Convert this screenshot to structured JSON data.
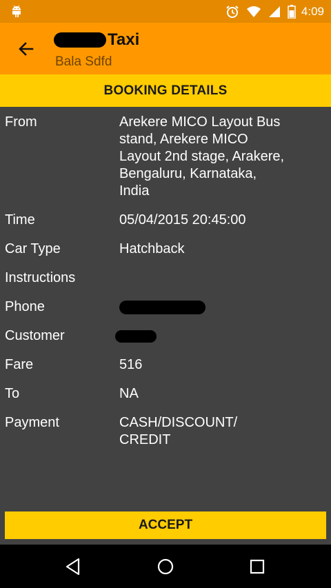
{
  "status_bar": {
    "time": "4:09",
    "icons": [
      "android-icon",
      "alarm-icon",
      "wifi-icon",
      "signal-icon",
      "battery-icon"
    ]
  },
  "app_bar": {
    "title": "Taxi",
    "subtitle": "Bala Sdfd"
  },
  "section": {
    "header": "BOOKING DETAILS"
  },
  "details": {
    "from_label": "From",
    "from_value": "Arekere MICO Layout Bus stand, Arekere MICO Layout 2nd stage, Arakere, Bengaluru, Karnataka, India",
    "time_label": "Time",
    "time_value": "05/04/2015 20:45:00",
    "car_type_label": "Car Type",
    "car_type_value": "Hatchback",
    "instructions_label": "Instructions",
    "instructions_value": "",
    "phone_label": "Phone",
    "customer_label": "Customer",
    "fare_label": "Fare",
    "fare_value": "516",
    "to_label": "To",
    "to_value": "NA",
    "payment_label": "Payment",
    "payment_value": "CASH/DISCOUNT/ CREDIT"
  },
  "actions": {
    "accept_label": "ACCEPT"
  },
  "colors": {
    "status_bar": "#e58a00",
    "app_bar": "#ff9800",
    "accent": "#ffcc00",
    "background": "#424242"
  }
}
